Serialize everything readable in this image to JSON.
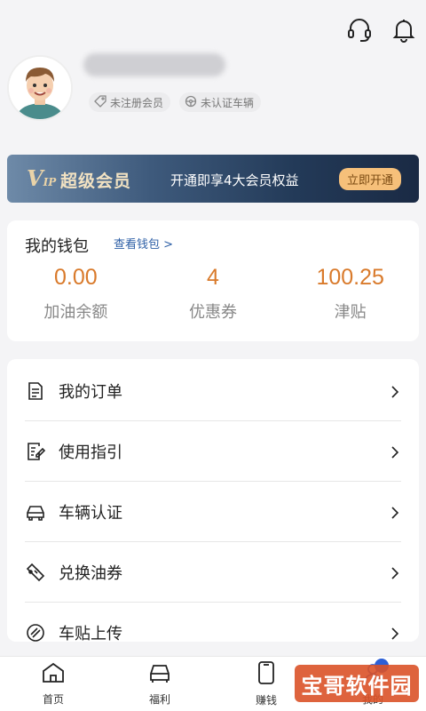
{
  "header": {
    "icons": [
      "headset-icon",
      "bell-icon"
    ]
  },
  "profile": {
    "badges": [
      {
        "icon": "tag-icon",
        "label": "未注册会员"
      },
      {
        "icon": "steering-wheel-icon",
        "label": "未认证车辆"
      }
    ]
  },
  "vip": {
    "logo": "V",
    "logo_sub": "IP",
    "title": "超级会员",
    "desc": "开通即享4大会员权益",
    "button": "立即开通"
  },
  "wallet": {
    "title": "我的钱包",
    "link": "查看钱包 >",
    "stats": [
      {
        "value": "0.00",
        "label": "加油余额"
      },
      {
        "value": "4",
        "label": "优惠券"
      },
      {
        "value": "100.25",
        "label": "津贴"
      }
    ]
  },
  "menu": {
    "items": [
      {
        "icon": "document-icon",
        "label": "我的订单"
      },
      {
        "icon": "edit-doc-icon",
        "label": "使用指引"
      },
      {
        "icon": "car-icon",
        "label": "车辆认证"
      },
      {
        "icon": "ticket-icon",
        "label": "兑换油券"
      },
      {
        "icon": "upload-sticker-icon",
        "label": "车贴上传"
      }
    ]
  },
  "tabbar": {
    "tabs": [
      {
        "icon": "home-icon",
        "label": "首页"
      },
      {
        "icon": "car-front-icon",
        "label": "福利"
      },
      {
        "icon": "phone-icon",
        "label": "赚钱"
      },
      {
        "icon": "user-icon",
        "label": "我的"
      }
    ]
  },
  "watermark": "宝哥软件园",
  "colors": {
    "accent_orange": "#d97a2b",
    "link_blue": "#2d5fa6",
    "vip_gold": "#f6c07a"
  }
}
